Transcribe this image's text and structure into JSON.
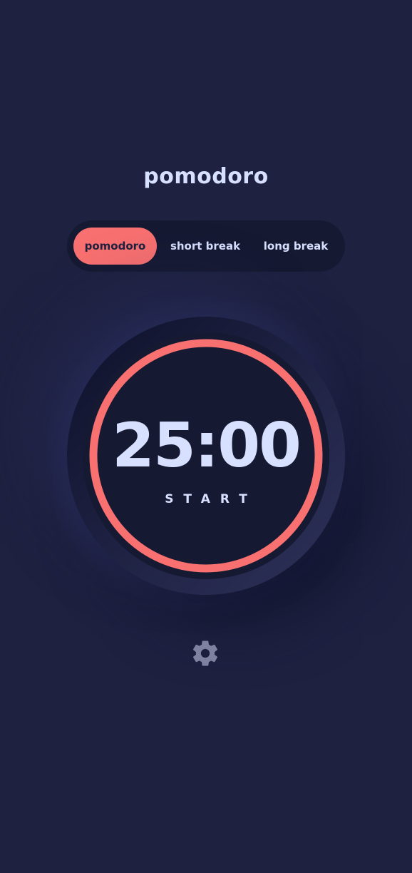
{
  "app": {
    "title": "pomodoro"
  },
  "tabs": [
    {
      "label": "pomodoro",
      "active": true
    },
    {
      "label": "short break",
      "active": false
    },
    {
      "label": "long break",
      "active": false
    }
  ],
  "timer": {
    "time": "25:00",
    "action_label": "START",
    "progress": 1.0
  },
  "settings": {
    "icon": "gear-icon"
  },
  "colors": {
    "background": "#1e2140",
    "accent": "#f87070",
    "text": "#d7e0ff",
    "dark": "#161932",
    "icon": "#7e82a0"
  }
}
